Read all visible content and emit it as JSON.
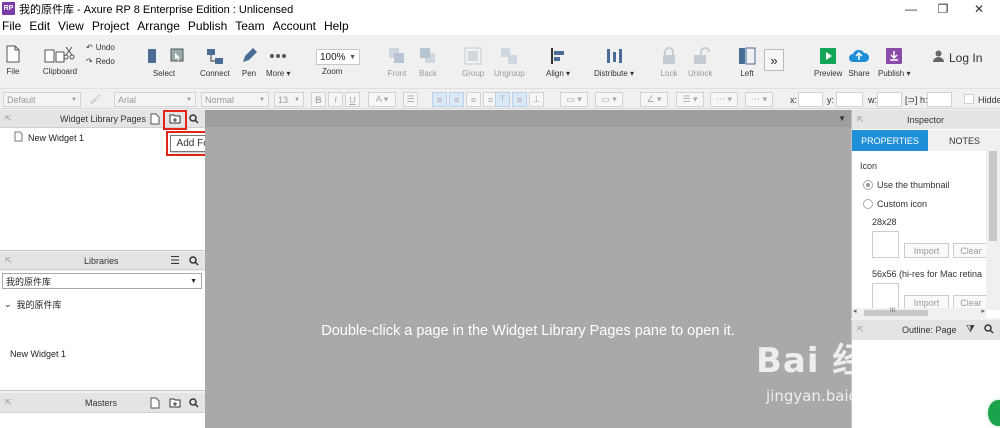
{
  "window": {
    "app_icon_text": "RP",
    "title": "我的原件库 - Axure RP 8 Enterprise Edition : Unlicensed",
    "minimize": "—",
    "maximize": "❐",
    "close": "✕"
  },
  "menu": [
    "File",
    "Edit",
    "View",
    "Project",
    "Arrange",
    "Publish",
    "Team",
    "Account",
    "Help"
  ],
  "toolbar": {
    "file": "File",
    "clipboard": "Clipboard",
    "undo": "Undo",
    "redo": "Redo",
    "select": "Select",
    "connect": "Connect",
    "pen": "Pen",
    "more": "More ▾",
    "zoom_value": "100%",
    "zoom_label": "Zoom",
    "front": "Front",
    "back": "Back",
    "group": "Group",
    "ungroup": "Ungroup",
    "align": "Align ▾",
    "distribute": "Distribute ▾",
    "lock": "Lock",
    "unlock": "Unlock",
    "left": "Left",
    "preview": "Preview",
    "share": "Share",
    "publish": "Publish ▾",
    "login": "Log In"
  },
  "format_bar": {
    "style": "Default",
    "font": "Arial",
    "weight": "Normal",
    "size": "13",
    "x_label": "x:",
    "y_label": "y:",
    "w_label": "w:",
    "h_label": "h:",
    "hidden_label": "Hidden"
  },
  "pages_pane": {
    "title": "Widget Library Pages",
    "items": [
      "New Widget 1"
    ],
    "tooltip": "Add Folder"
  },
  "libraries_pane": {
    "title": "Libraries",
    "selected_library": "我的原件库",
    "tree_root": "我的原件库",
    "items": [
      "New Widget 1"
    ]
  },
  "masters_pane": {
    "title": "Masters"
  },
  "canvas": {
    "message": "Double-click a page in the Widget Library Pages pane to open it."
  },
  "inspector": {
    "title": "Inspector",
    "tabs": [
      "PROPERTIES",
      "NOTES"
    ],
    "section": "Icon",
    "option_thumbnail": "Use the thumbnail",
    "option_custom": "Custom icon",
    "size_small": "28x28",
    "size_large": "56x56 (hi-res for Mac retina",
    "import": "Import",
    "clear": "Clear",
    "scroll_grip": "III"
  },
  "outline": {
    "title": "Outline: Page"
  },
  "watermark": {
    "logo": "Bai 经验",
    "url": "jingyan.baidu.com"
  },
  "colors": {
    "accent": "#1f8fd8",
    "highlight": "#e0251b",
    "canvas": "#a9a9a9"
  }
}
